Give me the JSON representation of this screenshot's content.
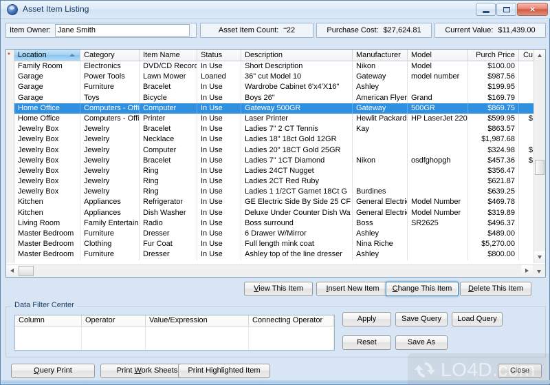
{
  "window": {
    "title": "Asset Item Listing",
    "icon": "app-icon",
    "controls": {
      "minimize": "minimize-button",
      "maximize": "maximize-button",
      "close": "×"
    }
  },
  "topbar": {
    "owner_label": "Item Owner:",
    "owner_value": "Jane Smith",
    "count_label": "Asset Item Count:",
    "count_fill": "''''''",
    "count_value": "22",
    "cost_label": "Purchase Cost:",
    "cost_value": "$27,624.81",
    "value_label": "Current Value:",
    "value_value": "$11,439.00"
  },
  "grid": {
    "columns": [
      "Location",
      "Category",
      "Item Name",
      "Status",
      "Description",
      "Manufacturer",
      "Model",
      "Purch Price",
      "Cu"
    ],
    "sorted_column": "Location",
    "selected_row_index": 4,
    "rows": [
      {
        "location": "Family Room",
        "category": "Electronics",
        "item_name": "DVD/CD Record",
        "status": "In Use",
        "description": "Short Description",
        "manufacturer": "Nikon",
        "model": "Model",
        "purch_price": "$100.00",
        "current_value": ""
      },
      {
        "location": "Garage",
        "category": "Power Tools",
        "item_name": "Lawn Mower",
        "status": "Loaned",
        "description": "36\" cut Model 10",
        "manufacturer": "Gateway",
        "model": "model number",
        "purch_price": "$987.56",
        "current_value": ""
      },
      {
        "location": "Garage",
        "category": "Furniture",
        "item_name": "Bracelet",
        "status": "In Use",
        "description": "Wardrobe Cabinet 6'x4'X16\"",
        "manufacturer": "Ashley",
        "model": "",
        "purch_price": "$199.95",
        "current_value": ""
      },
      {
        "location": "Garage",
        "category": "Toys",
        "item_name": "Bicycle",
        "status": "In Use",
        "description": "Boys 26\"",
        "manufacturer": "American Flyer",
        "model": "Grand",
        "purch_price": "$169.79",
        "current_value": ""
      },
      {
        "location": "Home Office",
        "category": "Computers - Offic",
        "item_name": "Computer",
        "status": "In Use",
        "description": "Gateway 500GR",
        "manufacturer": "Gateway",
        "model": "500GR",
        "purch_price": "$869.75",
        "current_value": ""
      },
      {
        "location": "Home Office",
        "category": "Computers - Offic",
        "item_name": "Printer",
        "status": "In Use",
        "description": "Laser Printer",
        "manufacturer": "Hewlit Packard",
        "model": "HP LaserJet 220",
        "purch_price": "$599.95",
        "current_value": "$"
      },
      {
        "location": "Jewelry Box",
        "category": "Jewelry",
        "item_name": "Bracelet",
        "status": "In Use",
        "description": "Ladies 7\" 2 CT Tennis",
        "manufacturer": "Kay",
        "model": "",
        "purch_price": "$863.57",
        "current_value": ""
      },
      {
        "location": "Jewelry Box",
        "category": "Jewelry",
        "item_name": "Necklace",
        "status": "In Use",
        "description": "Ladies 18\" 18ct Gold 12GR",
        "manufacturer": "",
        "model": "",
        "purch_price": "$1,987.68",
        "current_value": ""
      },
      {
        "location": "Jewelry Box",
        "category": "Jewelry",
        "item_name": "Computer",
        "status": "In Use",
        "description": "Ladies 20\" 18CT Gold 25GR",
        "manufacturer": "",
        "model": "",
        "purch_price": "$324.98",
        "current_value": "$"
      },
      {
        "location": "Jewelry Box",
        "category": "Jewelry",
        "item_name": "Bracelet",
        "status": "In Use",
        "description": "Ladies 7\" 1CT Diamond",
        "manufacturer": "Nikon",
        "model": "osdfghopgh",
        "purch_price": "$457.36",
        "current_value": "$"
      },
      {
        "location": "Jewelry Box",
        "category": "Jewelry",
        "item_name": "Ring",
        "status": "In Use",
        "description": "Ladies 24CT Nugget",
        "manufacturer": "",
        "model": "",
        "purch_price": "$356.47",
        "current_value": ""
      },
      {
        "location": "Jewelry Box",
        "category": "Jewelry",
        "item_name": "Ring",
        "status": "In Use",
        "description": "Ladies 2CT Red Ruby",
        "manufacturer": "",
        "model": "",
        "purch_price": "$621.87",
        "current_value": ""
      },
      {
        "location": "Jewelry Box",
        "category": "Jewelry",
        "item_name": "Ring",
        "status": "In Use",
        "description": "Ladies 1 1/2CT Garnet 18Ct G",
        "manufacturer": "Burdines",
        "model": "",
        "purch_price": "$639.25",
        "current_value": ""
      },
      {
        "location": "Kitchen",
        "category": "Appliances",
        "item_name": "Refrigerator",
        "status": "In Use",
        "description": "GE Electric Side By Side 25 CF",
        "manufacturer": "General Electric",
        "model": "Model Number",
        "purch_price": "$469.78",
        "current_value": ""
      },
      {
        "location": "Kitchen",
        "category": "Appliances",
        "item_name": "Dish Washer",
        "status": "In Use",
        "description": "Deluxe Under Counter Dish Wa",
        "manufacturer": "General Electric",
        "model": "Model Number",
        "purch_price": "$319.89",
        "current_value": ""
      },
      {
        "location": "Living Room",
        "category": "Family Entertainm",
        "item_name": "Radio",
        "status": "In Use",
        "description": "Boss surround",
        "manufacturer": "Boss",
        "model": "SR2625",
        "purch_price": "$496.37",
        "current_value": ""
      },
      {
        "location": "Master Bedroom",
        "category": "Furniture",
        "item_name": "Dresser",
        "status": "In Use",
        "description": "6 Drawer W/Mirror",
        "manufacturer": "Ashley",
        "model": "",
        "purch_price": "$489.00",
        "current_value": ""
      },
      {
        "location": "Master Bedroom",
        "category": "Clothing",
        "item_name": "Fur Coat",
        "status": "In Use",
        "description": "Full length mink coat",
        "manufacturer": "Nina Riche",
        "model": "",
        "purch_price": "$5,270.00",
        "current_value": ""
      },
      {
        "location": "Master Bedroom",
        "category": "Furniture",
        "item_name": "Dresser",
        "status": "In Use",
        "description": "Ashley top of the line dresser",
        "manufacturer": "Ashley",
        "model": "",
        "purch_price": "$800.00",
        "current_value": ""
      }
    ]
  },
  "item_actions": {
    "view": "View This Item",
    "insert": "Insert New Item",
    "change": "Change This Item",
    "delete": "Delete This Item",
    "focused": "Change This Item"
  },
  "filter": {
    "legend": "Data Filter Center",
    "columns": [
      "Column",
      "Operator",
      "Value/Expression",
      "Connecting Operator"
    ],
    "rows": [],
    "apply": "Apply",
    "save_query": "Save Query",
    "load_query": "Load Query",
    "reset": "Reset",
    "save_as": "Save As"
  },
  "footer": {
    "query_print": "Query Print",
    "print_work_sheets": "Print Work Sheets",
    "print_highlighted": "Print Highlighted Item",
    "close": "Close"
  },
  "watermark": {
    "text": "LO4D.com",
    "logo": "recycle-arrows-icon"
  },
  "colors": {
    "selection": "#2f8fe0",
    "title_text": "#123a63",
    "header_sorted": "#9fd2f2",
    "focus_ring": "#3c7fb1"
  }
}
